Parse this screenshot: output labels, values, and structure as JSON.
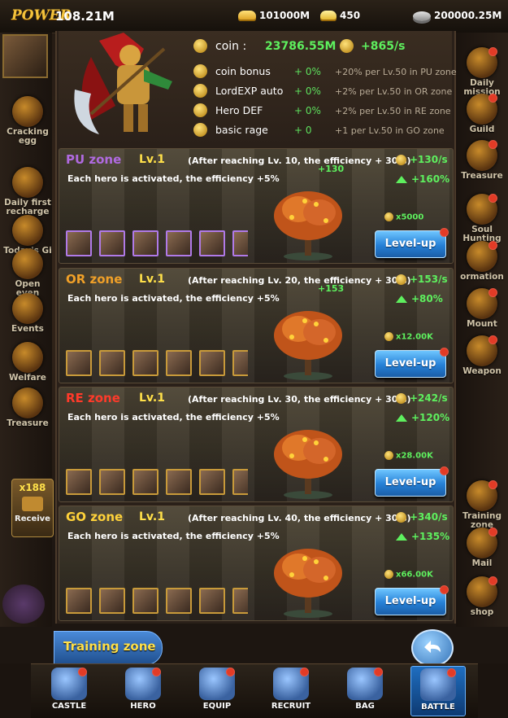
{
  "topbar": {
    "power_label": "POWER",
    "power_value": "108.21M",
    "gold": "101000M",
    "ingot": "450",
    "silver": "200000.25M"
  },
  "left_side": [
    {
      "label": "Cracking egg",
      "icon": "egg-icon"
    },
    {
      "label": "Daily first recharge",
      "icon": "gift-icon"
    },
    {
      "label": "Today's Gi",
      "icon": "gift-box-icon"
    },
    {
      "label": "Open even",
      "icon": "event-chest-icon"
    },
    {
      "label": "Events",
      "icon": "events-icon"
    },
    {
      "label": "Welfare",
      "icon": "welfare-icon"
    },
    {
      "label": "Treasure",
      "icon": "treasure-icon"
    }
  ],
  "left_extra": {
    "receive_count": "x188",
    "receive_label": "Receive"
  },
  "right_side": [
    {
      "label": "Daily mission",
      "icon": "scroll-icon"
    },
    {
      "label": "Guild",
      "icon": "guild-icon"
    },
    {
      "label": "Treasure",
      "icon": "treasure-icon"
    },
    {
      "label": "Soul Hunting",
      "icon": "soul-icon"
    },
    {
      "label": "ormation",
      "icon": "formation-icon"
    },
    {
      "label": "Mount",
      "icon": "mount-icon"
    },
    {
      "label": "Weapon",
      "icon": "weapon-icon"
    },
    {
      "label": "Training zone",
      "icon": "training-icon"
    },
    {
      "label": "Mail",
      "icon": "mail-icon"
    },
    {
      "label": "shop",
      "icon": "shop-icon"
    }
  ],
  "header": {
    "coin_label": "coin :",
    "coin_value": "23786.55M",
    "coin_rate": "+865/s",
    "stats": [
      {
        "label": "coin bonus",
        "pct": "+ 0%",
        "note": "+20% per Lv.50 in PU zone",
        "icon": "coin-icon"
      },
      {
        "label": "LordEXP auto",
        "pct": "+ 0%",
        "note": "+2% per Lv.50 in OR zone",
        "icon": "exp-icon"
      },
      {
        "label": "Hero DEF",
        "pct": "+ 0%",
        "note": "+2% per Lv.50 in RE zone",
        "icon": "swords-icon"
      },
      {
        "label": "basic rage",
        "pct": "+ 0",
        "note": "+1 per Lv.50 in GO zone",
        "icon": "rage-icon"
      }
    ]
  },
  "zones": [
    {
      "name": "PU zone",
      "color": "#b06ae0",
      "level": "Lv.1",
      "after": "(After reaching Lv. 10, the efficiency + 30%)",
      "desc": "Each hero is activated, the efficiency +5%",
      "rate": "+130/s",
      "boost": "+160%",
      "cost": "x5000",
      "float": "+130",
      "button": "Level-up",
      "hero_style": "purple",
      "hero_count": 6
    },
    {
      "name": "OR zone",
      "color": "#f0a028",
      "level": "Lv.1",
      "after": "(After reaching Lv. 20, the efficiency + 30%)",
      "desc": "Each hero is activated, the efficiency +5%",
      "rate": "+153/s",
      "boost": "+80%",
      "cost": "x12.00K",
      "float": "+153",
      "button": "Level-up",
      "hero_style": "gold",
      "hero_count": 6
    },
    {
      "name": "RE zone",
      "color": "#ff3a2a",
      "level": "Lv.1",
      "after": "(After reaching Lv. 30, the efficiency + 30%)",
      "desc": "Each hero is activated, the efficiency +5%",
      "rate": "+242/s",
      "boost": "+120%",
      "cost": "x28.00K",
      "float": "",
      "button": "Level-up",
      "hero_style": "gold",
      "hero_count": 6
    },
    {
      "name": "GO zone",
      "color": "#ffd23a",
      "level": "Lv.1",
      "after": "(After reaching Lv. 40, the efficiency + 30%)",
      "desc": "Each hero is activated, the efficiency +5%",
      "rate": "+340/s",
      "boost": "+135%",
      "cost": "x66.00K",
      "float": "",
      "button": "Level-up",
      "hero_style": "gold",
      "hero_count": 6
    }
  ],
  "footer": {
    "training_label": "Training zone"
  },
  "nav": [
    {
      "label": "CASTLE",
      "icon": "castle-icon",
      "badge": true,
      "active": false
    },
    {
      "label": "HERO",
      "icon": "helmet-icon",
      "badge": true,
      "active": false
    },
    {
      "label": "EQUIP",
      "icon": "equip-icon",
      "badge": true,
      "active": false
    },
    {
      "label": "RECRUIT",
      "icon": "recruit-icon",
      "badge": true,
      "active": false
    },
    {
      "label": "BAG",
      "icon": "bag-icon",
      "badge": true,
      "active": false
    },
    {
      "label": "BATTLE",
      "icon": "battle-icon",
      "badge": true,
      "active": true
    }
  ],
  "colors": {
    "accent_gold": "#ffe04a",
    "positive_green": "#5ef05e",
    "button_blue": "#2580d6"
  }
}
